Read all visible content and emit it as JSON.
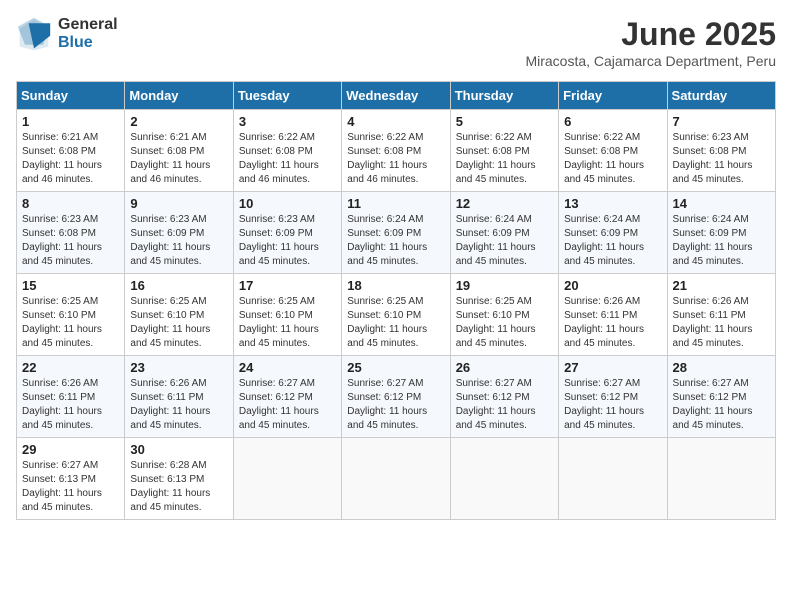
{
  "logo": {
    "general": "General",
    "blue": "Blue"
  },
  "title": "June 2025",
  "subtitle": "Miracosta, Cajamarca Department, Peru",
  "days": [
    "Sunday",
    "Monday",
    "Tuesday",
    "Wednesday",
    "Thursday",
    "Friday",
    "Saturday"
  ],
  "weeks": [
    [
      {
        "day": "1",
        "sunrise": "6:21 AM",
        "sunset": "6:08 PM",
        "daylight": "11 hours and 46 minutes."
      },
      {
        "day": "2",
        "sunrise": "6:21 AM",
        "sunset": "6:08 PM",
        "daylight": "11 hours and 46 minutes."
      },
      {
        "day": "3",
        "sunrise": "6:22 AM",
        "sunset": "6:08 PM",
        "daylight": "11 hours and 46 minutes."
      },
      {
        "day": "4",
        "sunrise": "6:22 AM",
        "sunset": "6:08 PM",
        "daylight": "11 hours and 46 minutes."
      },
      {
        "day": "5",
        "sunrise": "6:22 AM",
        "sunset": "6:08 PM",
        "daylight": "11 hours and 45 minutes."
      },
      {
        "day": "6",
        "sunrise": "6:22 AM",
        "sunset": "6:08 PM",
        "daylight": "11 hours and 45 minutes."
      },
      {
        "day": "7",
        "sunrise": "6:23 AM",
        "sunset": "6:08 PM",
        "daylight": "11 hours and 45 minutes."
      }
    ],
    [
      {
        "day": "8",
        "sunrise": "6:23 AM",
        "sunset": "6:08 PM",
        "daylight": "11 hours and 45 minutes."
      },
      {
        "day": "9",
        "sunrise": "6:23 AM",
        "sunset": "6:09 PM",
        "daylight": "11 hours and 45 minutes."
      },
      {
        "day": "10",
        "sunrise": "6:23 AM",
        "sunset": "6:09 PM",
        "daylight": "11 hours and 45 minutes."
      },
      {
        "day": "11",
        "sunrise": "6:24 AM",
        "sunset": "6:09 PM",
        "daylight": "11 hours and 45 minutes."
      },
      {
        "day": "12",
        "sunrise": "6:24 AM",
        "sunset": "6:09 PM",
        "daylight": "11 hours and 45 minutes."
      },
      {
        "day": "13",
        "sunrise": "6:24 AM",
        "sunset": "6:09 PM",
        "daylight": "11 hours and 45 minutes."
      },
      {
        "day": "14",
        "sunrise": "6:24 AM",
        "sunset": "6:09 PM",
        "daylight": "11 hours and 45 minutes."
      }
    ],
    [
      {
        "day": "15",
        "sunrise": "6:25 AM",
        "sunset": "6:10 PM",
        "daylight": "11 hours and 45 minutes."
      },
      {
        "day": "16",
        "sunrise": "6:25 AM",
        "sunset": "6:10 PM",
        "daylight": "11 hours and 45 minutes."
      },
      {
        "day": "17",
        "sunrise": "6:25 AM",
        "sunset": "6:10 PM",
        "daylight": "11 hours and 45 minutes."
      },
      {
        "day": "18",
        "sunrise": "6:25 AM",
        "sunset": "6:10 PM",
        "daylight": "11 hours and 45 minutes."
      },
      {
        "day": "19",
        "sunrise": "6:25 AM",
        "sunset": "6:10 PM",
        "daylight": "11 hours and 45 minutes."
      },
      {
        "day": "20",
        "sunrise": "6:26 AM",
        "sunset": "6:11 PM",
        "daylight": "11 hours and 45 minutes."
      },
      {
        "day": "21",
        "sunrise": "6:26 AM",
        "sunset": "6:11 PM",
        "daylight": "11 hours and 45 minutes."
      }
    ],
    [
      {
        "day": "22",
        "sunrise": "6:26 AM",
        "sunset": "6:11 PM",
        "daylight": "11 hours and 45 minutes."
      },
      {
        "day": "23",
        "sunrise": "6:26 AM",
        "sunset": "6:11 PM",
        "daylight": "11 hours and 45 minutes."
      },
      {
        "day": "24",
        "sunrise": "6:27 AM",
        "sunset": "6:12 PM",
        "daylight": "11 hours and 45 minutes."
      },
      {
        "day": "25",
        "sunrise": "6:27 AM",
        "sunset": "6:12 PM",
        "daylight": "11 hours and 45 minutes."
      },
      {
        "day": "26",
        "sunrise": "6:27 AM",
        "sunset": "6:12 PM",
        "daylight": "11 hours and 45 minutes."
      },
      {
        "day": "27",
        "sunrise": "6:27 AM",
        "sunset": "6:12 PM",
        "daylight": "11 hours and 45 minutes."
      },
      {
        "day": "28",
        "sunrise": "6:27 AM",
        "sunset": "6:12 PM",
        "daylight": "11 hours and 45 minutes."
      }
    ],
    [
      {
        "day": "29",
        "sunrise": "6:27 AM",
        "sunset": "6:13 PM",
        "daylight": "11 hours and 45 minutes."
      },
      {
        "day": "30",
        "sunrise": "6:28 AM",
        "sunset": "6:13 PM",
        "daylight": "11 hours and 45 minutes."
      },
      null,
      null,
      null,
      null,
      null
    ]
  ]
}
